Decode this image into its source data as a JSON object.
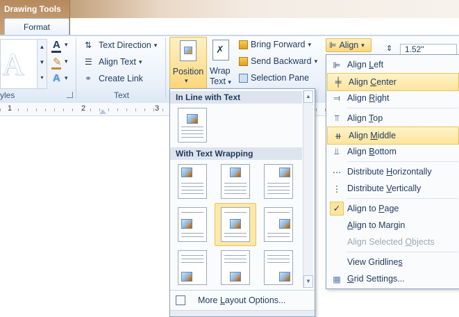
{
  "context_tab": {
    "group": "Drawing Tools",
    "tab": "Format"
  },
  "ribbon": {
    "styles_label": "yles",
    "text_group": {
      "text_direction": "Text Direction",
      "align_text": "Align Text",
      "create_link": "Create Link",
      "label": "Text"
    },
    "position_label": "Position",
    "wrap_text_label_1": "Wrap",
    "wrap_text_label_2": "Text",
    "arrange": {
      "bring_forward": "Bring Forward",
      "send_backward": "Send Backward",
      "selection_pane": "Selection Pane"
    },
    "align_button": "Align",
    "size_value": "1.52\""
  },
  "ruler": {
    "marks": [
      "1",
      "2",
      "3"
    ]
  },
  "position_menu": {
    "inline_heading": "In Line with Text",
    "wrapping_heading": "With Text Wrapping",
    "more_options": "More Layout Options..."
  },
  "align_menu": {
    "items": [
      {
        "label": "Align Left",
        "u": "L"
      },
      {
        "label": "Align Center",
        "u": "C"
      },
      {
        "label": "Align Right",
        "u": "R"
      },
      {
        "label": "Align Top",
        "u": "T"
      },
      {
        "label": "Align Middle",
        "u": "M"
      },
      {
        "label": "Align Bottom",
        "u": "B"
      },
      {
        "label": "Distribute Horizontally",
        "u": "H"
      },
      {
        "label": "Distribute Vertically",
        "u": "V"
      },
      {
        "label": "Align to Page",
        "u": "P"
      },
      {
        "label": "Align to Margin",
        "u": "A"
      },
      {
        "label": "Align Selected Objects",
        "u": "O"
      },
      {
        "label": "View Gridlines",
        "u": "S"
      },
      {
        "label": "Grid Settings...",
        "u": "G"
      }
    ]
  },
  "colors": {
    "accent": "#1e395b",
    "highlight": "#fde59d",
    "brown": "#b68a5d"
  }
}
